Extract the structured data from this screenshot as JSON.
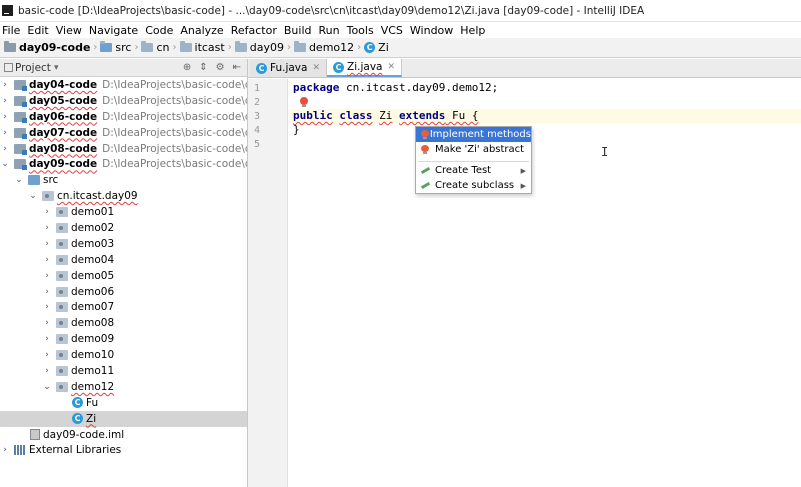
{
  "window": {
    "title": "basic-code [D:\\IdeaProjects\\basic-code] - ...\\day09-code\\src\\cn\\itcast\\day09\\demo12\\Zi.java [day09-code] - IntelliJ IDEA"
  },
  "menu": [
    "File",
    "Edit",
    "View",
    "Navigate",
    "Code",
    "Analyze",
    "Refactor",
    "Build",
    "Run",
    "Tools",
    "VCS",
    "Window",
    "Help"
  ],
  "breadcrumb": [
    "day09-code",
    "src",
    "cn",
    "itcast",
    "day09",
    "demo12",
    "Zi"
  ],
  "project_panel": {
    "title": "Project",
    "modules": [
      {
        "name": "day04-code",
        "path": "D:\\IdeaProjects\\basic-code\\day04-co"
      },
      {
        "name": "day05-code",
        "path": "D:\\IdeaProjects\\basic-code\\day05-co"
      },
      {
        "name": "day06-code",
        "path": "D:\\IdeaProjects\\basic-code\\day06-co"
      },
      {
        "name": "day07-code",
        "path": "D:\\IdeaProjects\\basic-code\\day07-co"
      },
      {
        "name": "day08-code",
        "path": "D:\\IdeaProjects\\basic-code\\day08-co"
      },
      {
        "name": "day09-code",
        "path": "D:\\IdeaProjects\\basic-code\\day09-co"
      }
    ],
    "src": "src",
    "package": "cn.itcast.day09",
    "packages": [
      "demo01",
      "demo02",
      "demo03",
      "demo04",
      "demo05",
      "demo06",
      "demo07",
      "demo08",
      "demo09",
      "demo10",
      "demo11",
      "demo12"
    ],
    "classes": [
      "Fu",
      "Zi"
    ],
    "iml": "day09-code.iml",
    "libraries": "External Libraries"
  },
  "editor": {
    "tabs": [
      {
        "label": "Fu.java",
        "active": false
      },
      {
        "label": "Zi.java",
        "active": true
      }
    ],
    "line_numbers": [
      "1",
      "2",
      "3",
      "4",
      "5"
    ],
    "code": {
      "l1_kw": "package",
      "l1_rest": " cn.itcast.day09.demo12;",
      "l3_kw1": "public",
      "l3_kw2": "class",
      "l3_name": "Zi",
      "l3_kw3": "extends",
      "l3_rest": " Fu {",
      "l4": "}"
    }
  },
  "popup": {
    "items": [
      {
        "label": "Implement methods",
        "icon": "bulb-icon",
        "selected": true
      },
      {
        "label": "Make 'Zi' abstract",
        "icon": "bulb-icon",
        "selected": false
      },
      {
        "label": "Create Test",
        "icon": "pencil-icon",
        "submenu": true
      },
      {
        "label": "Create subclass",
        "icon": "pencil-icon",
        "submenu": true
      }
    ]
  },
  "colors": {
    "selection": "#3875d7",
    "keyword": "#000080",
    "current_line": "#fffae3",
    "error_underline": "#e04040"
  }
}
